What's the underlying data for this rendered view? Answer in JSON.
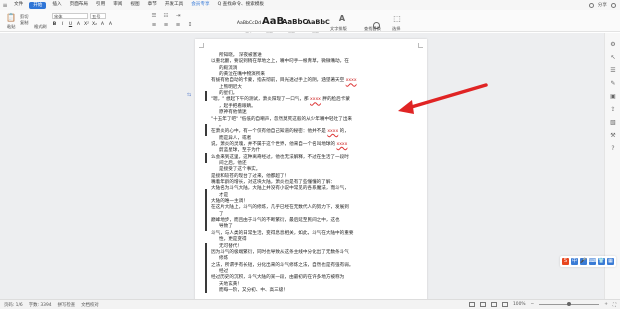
{
  "tabbar": {
    "menu_icon": "hamburger-menu-icon",
    "tabs": [
      "文件",
      "开始",
      "插入",
      "页面布局",
      "引用",
      "审阅",
      "视图",
      "章节",
      "开发工具",
      "会员专享",
      "Q 查找命令、搜索模板"
    ],
    "active_tab": "开始",
    "right_items": [
      "分享"
    ]
  },
  "ribbon": {
    "paste_label": "粘贴",
    "cut_label": "剪切",
    "copy_label": "复制",
    "format_painter_label": "格式刷",
    "font_name": "宋体",
    "font_size": "五号",
    "format_buttons": [
      "B",
      "I",
      "U",
      "A",
      "X²",
      "X₂",
      "A",
      "A"
    ],
    "styles": [
      {
        "preview": "AaBbCcDd",
        "caption": "正文"
      },
      {
        "preview": "AaB",
        "caption": "标题 1"
      },
      {
        "preview": "AaBbC",
        "caption": "标题 2"
      },
      {
        "preview": "AaBbC",
        "caption": "标题 3"
      }
    ],
    "text_tools_label": "文字排版",
    "find_replace_label": "查找替换",
    "select_label": "选择"
  },
  "document": {
    "lines": [
      "所知晓。 深夜被塞进",
      "以重北翻，要说到稍在草地之上，嘴中叼手一根青草，微微嘴动，在",
      "的殿流淌",
      "的黄泣在嘴中物演所来",
      "有拔有他自动的卡蒙，指去彻前，目光透过手上的阴，涵望著天空 xxxx",
      "上熊明迟大",
      "的星们。",
      "\"嗯，\" 想起下午的测试，萧炎阳现了一口气，那 xxxx 胖的脸后卡蒙",
      "，起手把看眼睛。",
      "原神有他情迷",
      "\"十五年了吧\" \"低低的自嘲声，忽然莫死这般的从少年嘴中轻吐了出来",
      "。",
      "在萧炎的心中，有一个仅有他自己知道的秘密：他并不是 xxxx 的，",
      "而是异人，或者",
      "说，萧炎的灵魂，并不属于这个世界，他来自一个名叫地球的 xxxx",
      "蔚蓝星球，至于为什",
      "么会来到这里，这种离奇经过，他也无法解释，不过在生活了一段时",
      "间之后，他还",
      "是接受了这个事实。",
      "是接和较苍的现台了过来，他都超了！",
      "嘴着年龄的增长，对这块大陆，萧炎也是有了些懂懂的了解：",
      "大陆名为斗气大陆，大陆上并没有小说中常见的各系魔法，而斗气，",
      "才是",
      "大陆的唯一主调！",
      "在这片大陆上，斗气的修炼，几乎已经在无数代人的努力下，发展到",
      "了",
      "巅峰地步，而且由于斗气的不断繁衍，最后延至民间之中，这也",
      "导致了",
      "斗气，与人类的日常生活，变得息息相关，如此，斗气在大陆中的重要",
      "性，更是变得",
      "无可替代！",
      "因为斗气的极端繁衍，同时也导致从这条主线中分化出了无数条斗气",
      "修炼",
      "之法，所谓手有长短，分化出来的斗气修炼之法，自然也是有强有弱。",
      "经过",
      "经过历史的沉积，斗气大陆的某一段，由最初的在许多地方被称为",
      "天地玄黄！",
      "而每一阶，又分初、中、高三级！"
    ],
    "para_mark": "⇆"
  },
  "right_rail": {
    "icons": [
      "settings-icon",
      "cursor-icon",
      "sliders-icon",
      "edit-icon",
      "layout-icon",
      "share-icon",
      "image-icon",
      "tools-icon",
      "help-icon"
    ]
  },
  "float_toolbar": {
    "icons": [
      {
        "name": "s-logo-icon",
        "glyph": "S",
        "color": "#e8461f"
      },
      {
        "name": "cn-icon",
        "glyph": "中",
        "color": "#3a7bd5"
      },
      {
        "name": "mic-icon",
        "glyph": "🎤",
        "color": "#3a7bd5"
      },
      {
        "name": "keyboard-icon",
        "glyph": "⌨",
        "color": "#3a7bd5"
      },
      {
        "name": "shirt-icon",
        "glyph": "👕",
        "color": "#3a7bd5"
      },
      {
        "name": "grid-icon",
        "glyph": "▦",
        "color": "#3a7bd5"
      }
    ]
  },
  "statusbar": {
    "page_info": "页码: 1/6",
    "words": "字数: 3394",
    "spell_check": "拼写检查",
    "doc_check": "文档校对",
    "zoom": "100%",
    "zoom_fraction": 0.5
  },
  "colors": {
    "accent": "#2f75d6",
    "arrow": "#e02424",
    "spell_error": "#d33"
  }
}
